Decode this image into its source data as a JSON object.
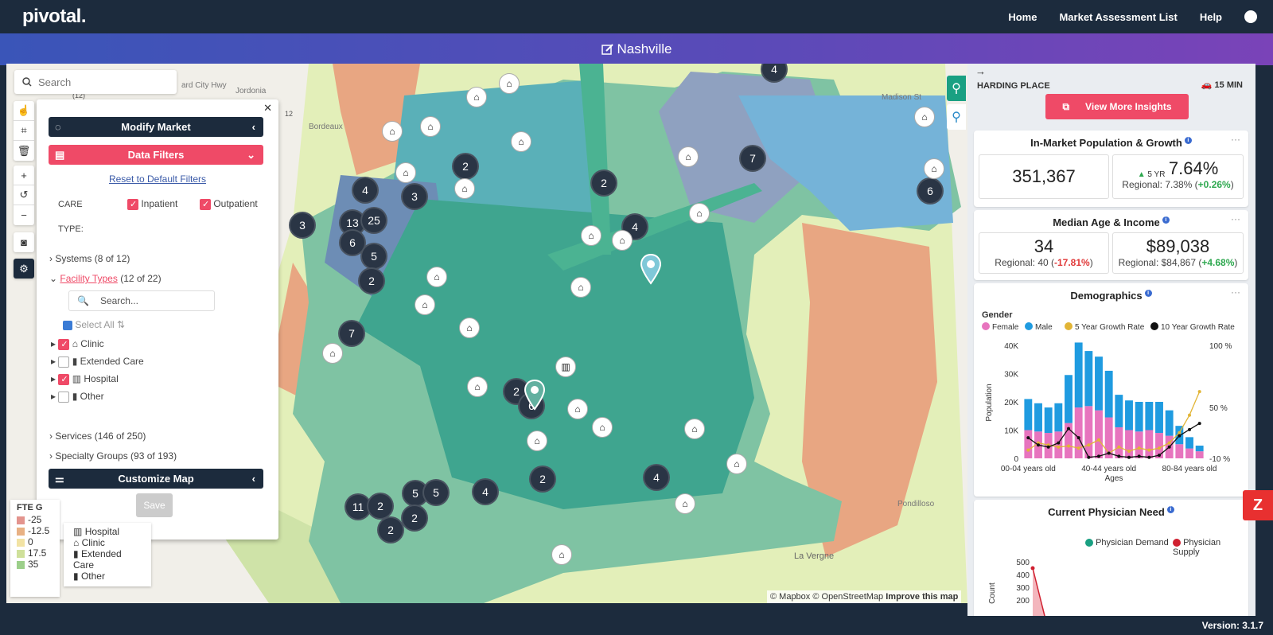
{
  "app": {
    "logo": "pivotal.",
    "nav": [
      "Home",
      "Market Assessment List",
      "Help"
    ],
    "title": "Nashville",
    "version": "Version: 3.1.7"
  },
  "map": {
    "search_placeholder": "Search",
    "clusters": [
      "4",
      "2",
      "7",
      "2",
      "4",
      "3",
      "4",
      "6",
      "13",
      "25",
      "3",
      "6",
      "5",
      "2",
      "7",
      "2",
      "6",
      "2",
      "4",
      "4",
      "5",
      "5",
      "11",
      "2",
      "2",
      "2"
    ],
    "road_labels": [
      "ard City Hwy",
      "Jordonia",
      "Bordeaux",
      "(12)",
      "12",
      "Madison St",
      "Pondilloso",
      "La Vergne"
    ],
    "attribution": "© Mapbox © OpenStreetMap",
    "improve": "Improve this map",
    "legend_fte": {
      "title": "FTE G",
      "items": [
        {
          "label": "-25",
          "color": "#e3948e"
        },
        {
          "label": "-12.5",
          "color": "#e8b184"
        },
        {
          "label": "0",
          "color": "#f2e3a4"
        },
        {
          "label": "17.5",
          "color": "#cfe09a"
        },
        {
          "label": "35",
          "color": "#9ccf8a"
        }
      ]
    },
    "legend_fac": {
      "items": [
        "Hospital",
        "Clinic",
        "Extended Care",
        "Other"
      ]
    }
  },
  "panel": {
    "modify": "Modify Market",
    "filters": "Data Filters",
    "reset": "Reset to Default Filters",
    "care_label": "CARE",
    "type_label": "TYPE:",
    "inpatient": "Inpatient",
    "outpatient": "Outpatient",
    "systems": "Systems",
    "systems_count": "(8 of 12)",
    "facility_types": "Facility Types",
    "facility_count": "(12 of 22)",
    "fsearch": "Search...",
    "select_all": "Select All",
    "types": [
      {
        "label": "Clinic",
        "checked": true
      },
      {
        "label": "Extended Care",
        "checked": false
      },
      {
        "label": "Hospital",
        "checked": true
      },
      {
        "label": "Other",
        "checked": false
      }
    ],
    "services": "Services (146 of 250)",
    "specialty": "Specialty Groups (93 of 193)",
    "customize": "Customize Map",
    "save": "Save"
  },
  "side": {
    "location": "HARDING PLACE",
    "drive": "15 MIN",
    "insights": "View More Insights",
    "pop": {
      "title": "In-Market Population & Growth",
      "value": "351,367",
      "yr": "5 YR",
      "growth": "7.64%",
      "regional": "Regional: 7.38% (",
      "regional_delta": "+0.26%",
      "close": ")"
    },
    "age": {
      "title": "Median Age & Income",
      "age": "34",
      "age_reg": "Regional: 40 (",
      "age_delta": "-17.81%",
      "income": "$89,038",
      "inc_reg": "Regional: $84,867 (",
      "inc_delta": "+4.68%",
      "close": ")"
    },
    "demo": {
      "title": "Demographics",
      "gender": "Gender"
    },
    "need": {
      "title": "Current Physician Need",
      "demand": "Physician Demand",
      "supply": "Physician Supply",
      "ylabel": "Count",
      "yticks": [
        "500",
        "400",
        "300",
        "200"
      ],
      "colors": {
        "demand": "#1aa082",
        "supply": "#d02030"
      }
    }
  },
  "chart_data": {
    "type": "bar",
    "title": "",
    "xlabel": "Ages",
    "ylabel": "Population",
    "categories": [
      "00-04 years old",
      "05-09",
      "10-14",
      "15-19",
      "20-24",
      "25-29",
      "30-34",
      "35-39",
      "40-44 years old",
      "45-49",
      "50-54",
      "55-59",
      "60-64",
      "65-69",
      "70-74",
      "75-79",
      "80-84 years old",
      "85+"
    ],
    "x_tick_labels": [
      "00-04 years old",
      "40-44 years old",
      "80-84 years old"
    ],
    "ylim": [
      0,
      40000
    ],
    "y_tick_labels": [
      "0",
      "10K",
      "20K",
      "30K",
      "40K"
    ],
    "y2_tick_labels": [
      "100 %",
      "50 %",
      "-10 %"
    ],
    "series": [
      {
        "name": "Female",
        "color": "#e774be",
        "values": [
          10000,
          9500,
          9000,
          9500,
          12500,
          18000,
          18500,
          17000,
          14500,
          11000,
          10000,
          9500,
          10000,
          9000,
          8000,
          5000,
          3500,
          2500
        ]
      },
      {
        "name": "Male",
        "color": "#1f9be0",
        "values": [
          11000,
          10000,
          9000,
          10000,
          17000,
          23000,
          19500,
          19000,
          16500,
          11500,
          10500,
          10500,
          10000,
          11000,
          9000,
          6500,
          4000,
          2000
        ]
      },
      {
        "name": "5 Year Growth Rate",
        "color": "#e2b536",
        "values": [
          -2,
          5,
          3,
          1,
          2,
          0,
          3,
          8,
          -5,
          1,
          -3,
          0,
          -2,
          0,
          5,
          15,
          32,
          55
        ]
      },
      {
        "name": "10 Year Growth Rate",
        "color": "#111111",
        "values": [
          10,
          3,
          1,
          5,
          19,
          10,
          -9,
          -8,
          -5,
          -8,
          -9,
          -8,
          -9,
          -7,
          1,
          12,
          18,
          24
        ]
      }
    ],
    "legend": "top"
  }
}
